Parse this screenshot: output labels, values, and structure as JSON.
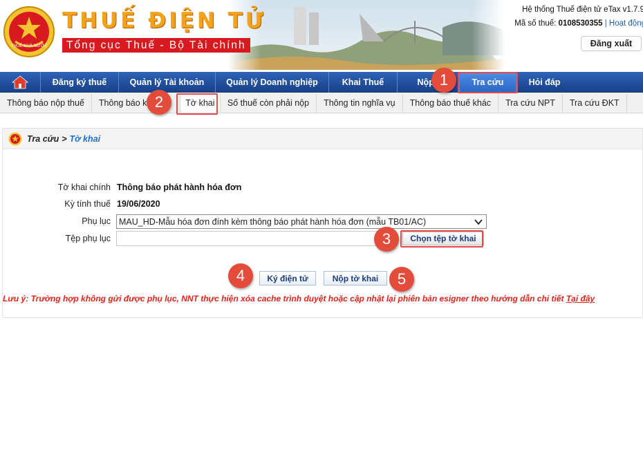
{
  "header": {
    "brand_title": "THUẾ ĐIỆN TỬ",
    "brand_subtitle": "Tổng cục Thuế - Bộ Tài chính",
    "emblem_text": "THUẾ NHÀ NƯỚC",
    "system_name": "Hệ thống Thuế điện tử eTax v1.7.9",
    "tax_id_label": "Mã số thuế:",
    "tax_id_value": "0108530355",
    "activity_link": "Hoạt động",
    "logout_label": "Đăng xuất"
  },
  "main_nav": {
    "home_icon": "home-icon",
    "items": [
      {
        "label": "Đăng ký thuế"
      },
      {
        "label": "Quản lý Tài khoản"
      },
      {
        "label": "Quản lý Doanh nghiệp"
      },
      {
        "label": "Khai Thuế"
      },
      {
        "label": "Nộp t"
      },
      {
        "label": "Tra cứu",
        "active": true
      },
      {
        "label": "Hỏi đáp"
      }
    ]
  },
  "sub_nav": {
    "items": [
      {
        "label": "Thông báo nộp thuế"
      },
      {
        "label": "Thông báo kh"
      },
      {
        "label": "Tờ khai",
        "active": true
      },
      {
        "label": "Số thuế còn phải nộp"
      },
      {
        "label": "Thông tin nghĩa vụ"
      },
      {
        "label": "Thông báo thuế khác"
      },
      {
        "label": "Tra cứu NPT"
      },
      {
        "label": "Tra cứu ĐKT"
      }
    ]
  },
  "breadcrumb": {
    "root": "Tra cứu",
    "separator": ">",
    "current": "Tờ khai"
  },
  "form": {
    "declaration_label": "Tờ khai chính",
    "declaration_value": "Thông báo phát hành hóa đơn",
    "period_label": "Kỳ tính thuế",
    "period_value": "19/06/2020",
    "appendix_label": "Phụ lục",
    "appendix_selected": "MAU_HD-Mẫu hóa đơn đính kèm thông báo phát hành hóa đơn (mẫu TB01/AC)",
    "appendix_file_label": "Tệp phụ lục",
    "appendix_file_value": "",
    "choose_file_label": "Chọn tệp tờ khai",
    "sign_label": "Ký điện tử",
    "submit_label": "Nộp tờ khai"
  },
  "note": {
    "prefix": "Lưu ý:",
    "text": " Trường hợp không gửi được phụ lục, NNT thực hiện xóa cache trình duyệt hoặc cập nhật lại phiên bản esigner theo hướng dẫn chi tiết ",
    "link": "Tại đây"
  },
  "annotations": [
    "1",
    "2",
    "3",
    "4",
    "5"
  ],
  "colors": {
    "nav_blue": "#1f4d9b",
    "nav_active": "#3a7ad6",
    "brand_orange": "#f2a21b",
    "brand_red": "#d71920",
    "note_red": "#e2231a",
    "marker_red": "#e34b3b"
  }
}
